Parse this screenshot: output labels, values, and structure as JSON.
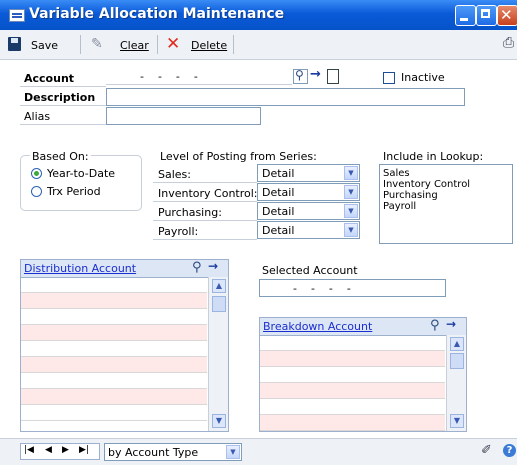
{
  "window": {
    "title": "Variable Allocation Maintenance"
  },
  "toolbar": {
    "save_label": "Save",
    "clear_label": "Clear",
    "delete_label": "Delete"
  },
  "account": {
    "label": "Account",
    "mask": "-    -    -    -",
    "inactive_label": "Inactive",
    "inactive_checked": false,
    "description_label": "Description",
    "description_value": "",
    "alias_label": "Alias",
    "alias_value": ""
  },
  "based_on": {
    "title": "Based On:",
    "options": [
      "Year-to-Date",
      "Trx Period"
    ],
    "selected": "Year-to-Date"
  },
  "posting": {
    "title": "Level of Posting from Series:",
    "rows": [
      {
        "label": "Sales:",
        "value": "Detail"
      },
      {
        "label": "Inventory Control:",
        "value": "Detail"
      },
      {
        "label": "Purchasing:",
        "value": "Detail"
      },
      {
        "label": "Payroll:",
        "value": "Detail"
      }
    ]
  },
  "lookup": {
    "title": "Include in Lookup:",
    "items": [
      "Sales",
      "Inventory Control",
      "Purchasing",
      "Payroll"
    ]
  },
  "distribution": {
    "header": "Distribution Account"
  },
  "selected_account": {
    "label": "Selected Account",
    "mask": "-    -    -    -"
  },
  "breakdown": {
    "header": "Breakdown Account"
  },
  "footer": {
    "sort_value": "by Account Type"
  },
  "colors": {
    "titlebar": "#0a5ad8",
    "link": "#1a2fd0",
    "alt_row": "#ffe8e8"
  }
}
